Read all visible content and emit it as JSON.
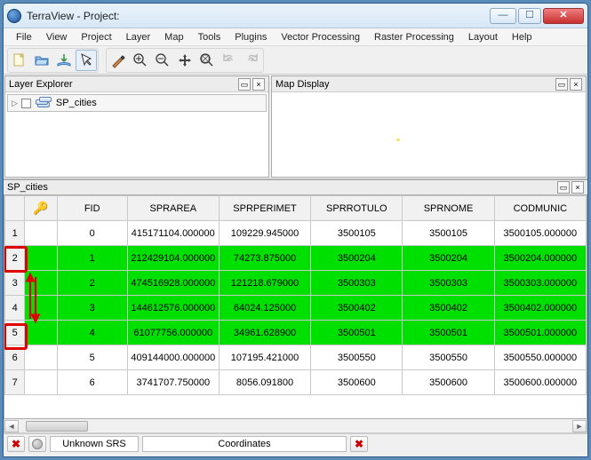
{
  "window": {
    "app_name": "TerraView",
    "title_sep": " - ",
    "title_label": "Project:",
    "title_faded": ""
  },
  "menu": {
    "items": [
      "File",
      "View",
      "Project",
      "Layer",
      "Map",
      "Tools",
      "Plugins",
      "Vector Processing",
      "Raster Processing",
      "Layout",
      "Help"
    ]
  },
  "panels": {
    "layer_explorer": {
      "title": "Layer Explorer",
      "tree_item": "SP_cities"
    },
    "map_display": {
      "title": "Map Display"
    }
  },
  "table": {
    "title": "SP_cities",
    "columns": [
      "",
      "FID",
      "SPRAREA",
      "SPRPERIMET",
      "SPRROTULO",
      "SPRNOME",
      "CODMUNIC"
    ],
    "rows": [
      {
        "n": "1",
        "sel": false,
        "cells": [
          "0",
          "415171104.000000",
          "109229.945000",
          "3500105",
          "3500105",
          "3500105.000000"
        ]
      },
      {
        "n": "2",
        "sel": true,
        "cells": [
          "1",
          "212429104.000000",
          "74273.875000",
          "3500204",
          "3500204",
          "3500204.000000"
        ]
      },
      {
        "n": "3",
        "sel": true,
        "cells": [
          "2",
          "474516928.000000",
          "121218.679000",
          "3500303",
          "3500303",
          "3500303.000000"
        ]
      },
      {
        "n": "4",
        "sel": true,
        "cells": [
          "3",
          "144612576.000000",
          "64024.125000",
          "3500402",
          "3500402",
          "3500402.000000"
        ]
      },
      {
        "n": "5",
        "sel": true,
        "cells": [
          "4",
          "61077756.000000",
          "34961.628900",
          "3500501",
          "3500501",
          "3500501.000000"
        ]
      },
      {
        "n": "6",
        "sel": false,
        "cells": [
          "5",
          "409144000.000000",
          "107195.421000",
          "3500550",
          "3500550",
          "3500550.000000"
        ]
      },
      {
        "n": "7",
        "sel": false,
        "cells": [
          "6",
          "3741707.750000",
          "8056.091800",
          "3500600",
          "3500600",
          "3500600.000000"
        ]
      }
    ]
  },
  "status": {
    "srs_label": "Unknown SRS",
    "coords_label": "Coordinates"
  }
}
